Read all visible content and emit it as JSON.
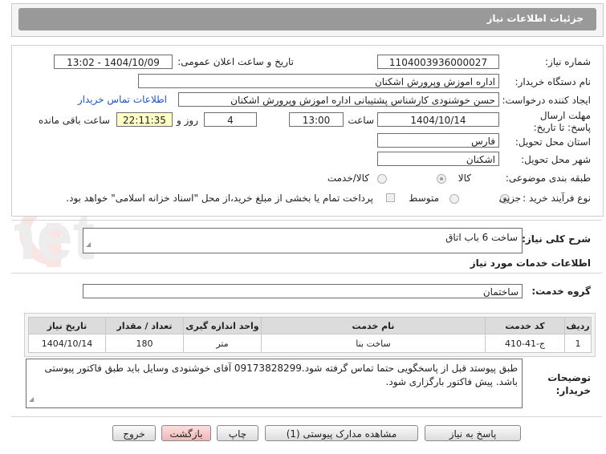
{
  "header": {
    "title": "جزئیات اطلاعات نیاز"
  },
  "form": {
    "need_number_label": "شماره نیاز:",
    "need_number": "1104003936000027",
    "announce_label": "تاریخ و ساعت اعلان عمومی:",
    "announce_value": "1404/10/09 - 13:02",
    "buyer_org_label": "نام دستگاه خریدار:",
    "buyer_org": "اداره اموزش وپرورش اشکنان",
    "creator_label": "ایجاد کننده درخواست:",
    "creator": "حسن خوشنودی کارشناس پشتیبانی اداره اموزش وپرورش اشکنان",
    "contact_link": "اطلاعات تماس خریدار",
    "deadline_label": "مهلت ارسال پاسخ: تا تاریخ:",
    "deadline_date": "1404/10/14",
    "time_label": "ساعت",
    "deadline_time": "13:00",
    "days": "4",
    "days_label": "روز و",
    "remaining": "22:11:35",
    "remaining_label": "ساعت باقی مانده",
    "province_label": "استان محل تحویل:",
    "province": "فارس",
    "city_label": "شهر محل تحویل:",
    "city": "اشکنان",
    "category_label": "طبقه بندی موضوعی:",
    "category_options": [
      "کالا",
      "کالا/خدمت"
    ],
    "process_label": "نوع فرآیند خرید :",
    "process_options": [
      "جزیی",
      "متوسط"
    ],
    "payment_note": "پرداخت تمام یا بخشی از مبلغ خرید،از محل \"اسناد خزانه اسلامی\" خواهد بود."
  },
  "description": {
    "label": "شرح کلی نیاز:",
    "value": "ساخت 6 باب اتاق"
  },
  "services": {
    "section_title": "اطلاعات خدمات مورد نیاز",
    "group_label": "گروه خدمت:",
    "group_value": "ساختمان"
  },
  "table": {
    "headers": [
      "ردیف",
      "کد خدمت",
      "نام خدمت",
      "واحد اندازه گیری",
      "تعداد / مقدار",
      "تاریخ نیاز"
    ],
    "rows": [
      [
        "1",
        "ج-41-410",
        "ساخت بنا",
        "متر",
        "180",
        "1404/10/14"
      ]
    ]
  },
  "notes": {
    "label": "توضیحات خریدار:",
    "value": "طبق پیوستد قبل از پاسخگویی حتما تماس گرفته شود.09173828299 آقای خوشنودی وسایل باید طبق فاکتور پیوستی باشد. پیش فاکتور بارگزاری شود."
  },
  "buttons": {
    "reply": "پاسخ به نیاز",
    "attachments": "مشاهده مدارک پیوستی (1)",
    "print": "چاپ",
    "back": "بازگشت",
    "exit": "خروج"
  },
  "watermark": {
    "text": "AriaTender.net"
  },
  "colors": {
    "header_bar": "#999999",
    "link": "#1a55c8",
    "remaining_bg": "#ffffc6",
    "back_button": "#f0b6b6"
  }
}
